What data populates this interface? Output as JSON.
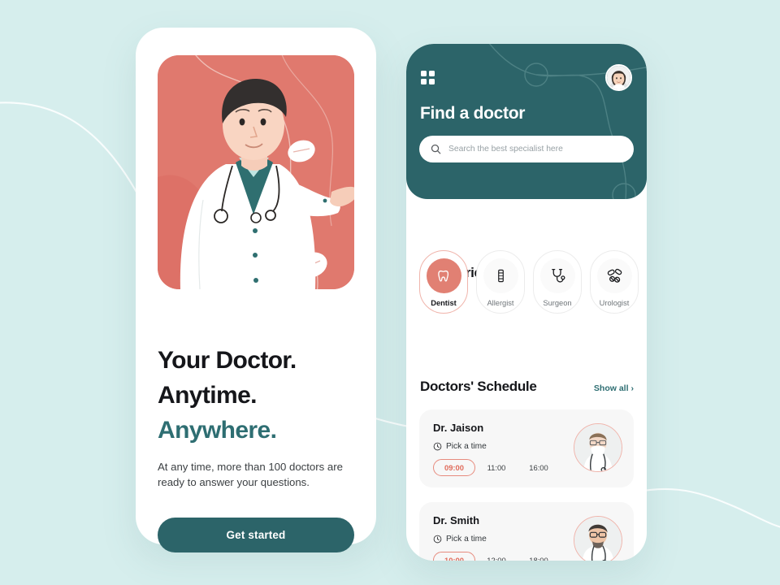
{
  "theme": {
    "background": "#d6eeed",
    "teal": "#2c6469",
    "teal_accent": "#2e6e72",
    "coral": "#e18073",
    "coral_text": "#e06c5c",
    "card_grey": "#f7f7f7",
    "text_dark": "#15161a"
  },
  "left_screen": {
    "illustration_name": "doctor-illustration",
    "headline_line1": "Your Doctor.",
    "headline_line2": "Anytime.",
    "headline_line3": "Anywhere.",
    "subtext": "At any time, more than 100 doctors are ready to answer your questions.",
    "cta_label": "Get started"
  },
  "right_screen": {
    "header": {
      "menu_icon": "grid-menu-icon",
      "avatar_alt": "user-avatar",
      "title": "Find a doctor",
      "search": {
        "icon": "search-icon",
        "placeholder": "Search the best specialist here",
        "value": ""
      }
    },
    "categories": {
      "title": "Categories",
      "items": [
        {
          "label": "Dentist",
          "icon": "tooth-icon",
          "active": true
        },
        {
          "label": "Allergist",
          "icon": "vial-icon",
          "active": false
        },
        {
          "label": "Surgeon",
          "icon": "stethoscope-icon",
          "active": false
        },
        {
          "label": "Urologist",
          "icon": "pills-icon",
          "active": false
        }
      ]
    },
    "schedule": {
      "title": "Doctors' Schedule",
      "show_all_label": "Show all",
      "show_all_chevron": "›",
      "pick_a_time_label": "Pick a time",
      "clock_icon": "clock-icon",
      "doctors": [
        {
          "name": "Dr. Jaison",
          "photo_alt": "doctor-jaison-photo",
          "times": [
            {
              "time": "09:00",
              "selected": true
            },
            {
              "time": "11:00",
              "selected": false
            },
            {
              "time": "16:00",
              "selected": false
            }
          ]
        },
        {
          "name": "Dr. Smith",
          "photo_alt": "doctor-smith-photo",
          "times": [
            {
              "time": "10:00",
              "selected": true
            },
            {
              "time": "12:00",
              "selected": false
            },
            {
              "time": "18:00",
              "selected": false
            }
          ]
        }
      ]
    }
  }
}
